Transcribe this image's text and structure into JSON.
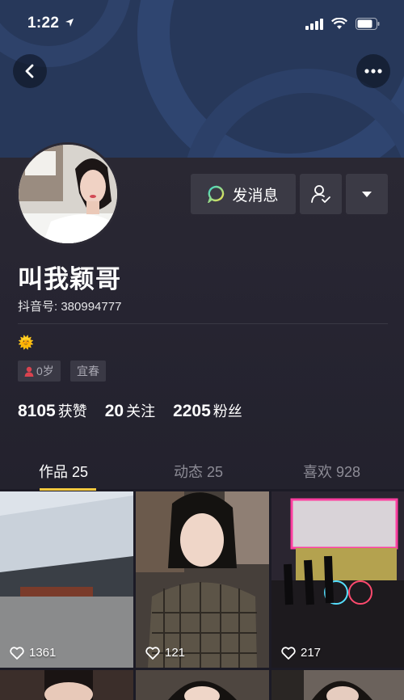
{
  "status_bar": {
    "time": "1:22"
  },
  "profile": {
    "name": "叫我颖哥",
    "douyin_id": "抖音号: 380994777",
    "emoji": "🌞",
    "tags": [
      {
        "label": "0岁"
      },
      {
        "label": "宜春"
      }
    ]
  },
  "actions": {
    "message_label": "发消息"
  },
  "stats": [
    {
      "value": "8105",
      "label": "获赞"
    },
    {
      "value": "20",
      "label": "关注"
    },
    {
      "value": "2205",
      "label": "粉丝"
    }
  ],
  "tabs": [
    {
      "label": "作品 25",
      "active": true
    },
    {
      "label": "动态 25",
      "active": false
    },
    {
      "label": "喜欢 928",
      "active": false
    }
  ],
  "videos": [
    {
      "likes": "1361"
    },
    {
      "likes": "121"
    },
    {
      "likes": "217"
    }
  ],
  "colors": {
    "banner": "#27385a",
    "background": "#1c1b26",
    "button": "#3b3a45",
    "tab_indicator": "#f7c93e",
    "message_icon_gradient": [
      "#3ad6c9",
      "#f5e04a"
    ]
  }
}
